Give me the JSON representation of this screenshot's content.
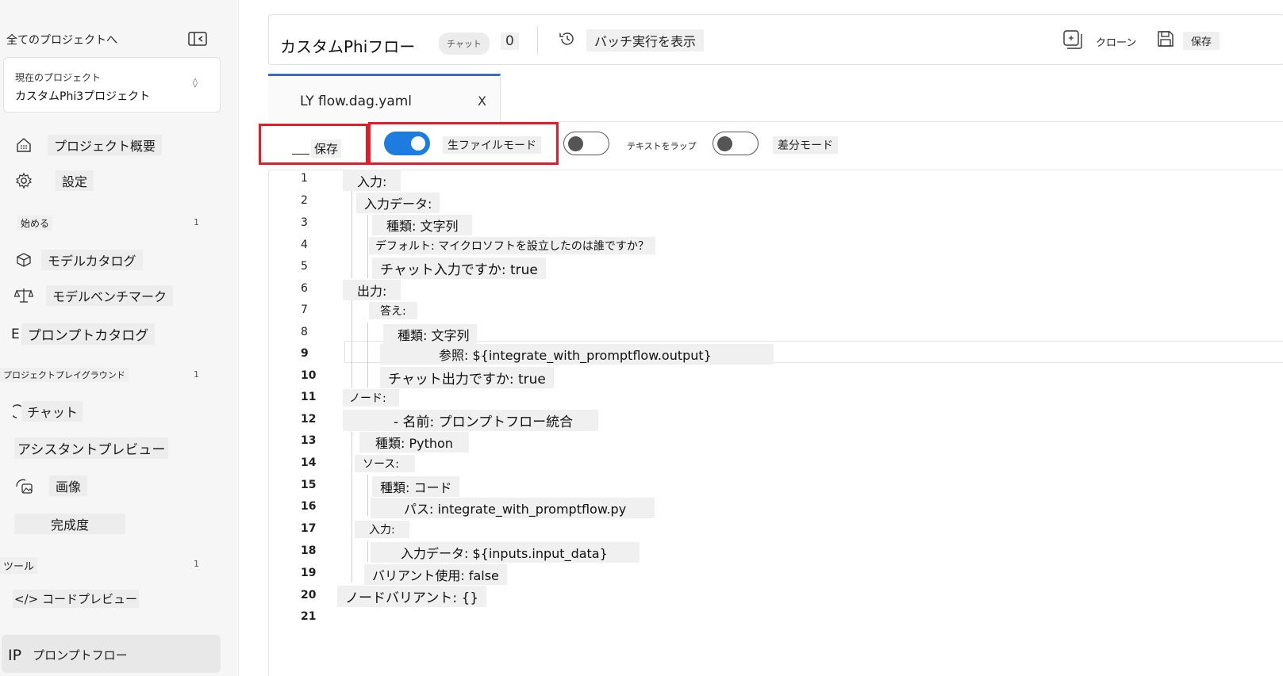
{
  "sidebar": {
    "back_link": "全てのプロジェクトへ",
    "project_label": "現在のプロジェクト",
    "project_name": "カスタムPhi3プロジェクト",
    "items": {
      "overview": "プロジェクト概要",
      "settings": "設定",
      "model_catalog": "モデルカタログ",
      "model_benchmark": "モデルベンチマーク",
      "prompt_catalog_prefix": "E",
      "prompt_catalog": "プロンプトカタログ",
      "chat": "チャット",
      "assistant_preview": "アシスタントプレビュー",
      "image": "画像",
      "completion": "完成度",
      "code_preview": "</> コードプレビュー",
      "prompt_flow_prefix": "IP",
      "prompt_flow": "プロンプトフロー"
    },
    "sections": {
      "get_started": "始める",
      "get_started_count": "1",
      "playground": "プロジェクトプレイグラウンド",
      "playground_count": "1",
      "tools": "ツール",
      "tools_count": "1"
    }
  },
  "header": {
    "title": "カスタムPhiフロー",
    "chat_pill": "チャット",
    "count": "0",
    "batch_label": "バッチ実行を表示",
    "clone_label": "クローン",
    "save_label": "保存"
  },
  "tab": {
    "name": "LY flow.dag.yaml",
    "close": "X"
  },
  "toolbar": {
    "save_label": "保存",
    "raw_mode_label": "生ファイルモード",
    "raw_mode_on": true,
    "wrap_label": "テキストをラップ",
    "wrap_on": false,
    "diff_label": "差分モード",
    "diff_on": false
  },
  "code_lines": [
    {
      "n": "1",
      "t": "入力:"
    },
    {
      "n": "2",
      "t": "入力データ:"
    },
    {
      "n": "3",
      "t": "種類: 文字列"
    },
    {
      "n": "4",
      "t": "デフォルト: マイクロソフトを設立したのは誰ですか？"
    },
    {
      "n": "5",
      "t": "チャット入力ですか: true"
    },
    {
      "n": "6",
      "t": "出力:"
    },
    {
      "n": "7",
      "t": "答え:"
    },
    {
      "n": "8",
      "t": "種類: 文字列"
    },
    {
      "n": "9",
      "t": "参照: ${integrate_with_promptflow.output}"
    },
    {
      "n": "10",
      "t": "チャット出力ですか: true"
    },
    {
      "n": "11",
      "t": "ノード:"
    },
    {
      "n": "12",
      "t": "- 名前: プロンプトフロー統合"
    },
    {
      "n": "13",
      "t": "種類: Python"
    },
    {
      "n": "14",
      "t": "ソース:"
    },
    {
      "n": "15",
      "t": "種類: コード"
    },
    {
      "n": "16",
      "t": "パス: integrate_with_promptflow.py"
    },
    {
      "n": "17",
      "t": "入力:"
    },
    {
      "n": "18",
      "t": "入力データ: ${inputs.input_data}"
    },
    {
      "n": "19",
      "t": "バリアント使用: false"
    },
    {
      "n": "20",
      "t": "ノードバリアント: {}"
    },
    {
      "n": "21",
      "t": ""
    }
  ]
}
